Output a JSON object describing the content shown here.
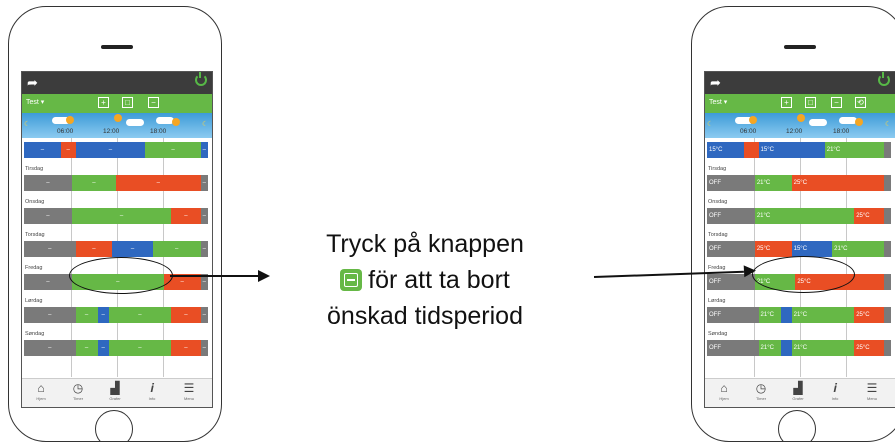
{
  "caption": {
    "line1": "Tryck på knappen",
    "line2": "för att ta bort",
    "line3": "önskad tidsperiod"
  },
  "colors": {
    "green": "#66b846",
    "red": "#e94e24",
    "blue": "#2f68c0",
    "gray": "#7a7a7a"
  },
  "left": {
    "program": "Test",
    "toolbar": [
      "+",
      "□",
      "−"
    ],
    "times": [
      "06:00",
      "12:00",
      "18:00"
    ],
    "rows": [
      {
        "day": "",
        "segs": [
          {
            "c": "blue",
            "w": 0.2,
            "t": "–"
          },
          {
            "c": "red",
            "w": 0.08,
            "t": "–"
          },
          {
            "c": "blue",
            "w": 0.38,
            "t": "–"
          },
          {
            "c": "green",
            "w": 0.3,
            "t": "–"
          },
          {
            "c": "blue",
            "w": 0.04,
            "t": "–"
          }
        ]
      },
      {
        "day": "Tirsdag",
        "segs": [
          {
            "c": "gray",
            "w": 0.26,
            "t": "–"
          },
          {
            "c": "green",
            "w": 0.24,
            "t": "–"
          },
          {
            "c": "red",
            "w": 0.46,
            "t": "–"
          },
          {
            "c": "gray",
            "w": 0.04,
            "t": "–"
          }
        ]
      },
      {
        "day": "Onsdag",
        "segs": [
          {
            "c": "gray",
            "w": 0.26,
            "t": "–"
          },
          {
            "c": "green",
            "w": 0.54,
            "t": "–"
          },
          {
            "c": "red",
            "w": 0.16,
            "t": "–"
          },
          {
            "c": "gray",
            "w": 0.04,
            "t": "–"
          }
        ]
      },
      {
        "day": "Torsdag",
        "segs": [
          {
            "c": "gray",
            "w": 0.28,
            "t": "–"
          },
          {
            "c": "red",
            "w": 0.2,
            "t": "–"
          },
          {
            "c": "blue",
            "w": 0.22,
            "t": "–"
          },
          {
            "c": "green",
            "w": 0.26,
            "t": "–"
          },
          {
            "c": "gray",
            "w": 0.04,
            "t": "–"
          }
        ]
      },
      {
        "day": "Fredag",
        "segs": [
          {
            "c": "gray",
            "w": 0.26,
            "t": "–"
          },
          {
            "c": "green",
            "w": 0.5,
            "t": "–"
          },
          {
            "c": "red",
            "w": 0.2,
            "t": "–"
          },
          {
            "c": "gray",
            "w": 0.04,
            "t": "–"
          }
        ]
      },
      {
        "day": "Lørdag",
        "segs": [
          {
            "c": "gray",
            "w": 0.28,
            "t": "–"
          },
          {
            "c": "green",
            "w": 0.12,
            "t": "–"
          },
          {
            "c": "blue",
            "w": 0.06,
            "t": "–"
          },
          {
            "c": "green",
            "w": 0.34,
            "t": "–"
          },
          {
            "c": "red",
            "w": 0.16,
            "t": "–"
          },
          {
            "c": "gray",
            "w": 0.04,
            "t": "–"
          }
        ]
      },
      {
        "day": "Søndag",
        "segs": [
          {
            "c": "gray",
            "w": 0.28,
            "t": "–"
          },
          {
            "c": "green",
            "w": 0.12,
            "t": "–"
          },
          {
            "c": "blue",
            "w": 0.06,
            "t": "–"
          },
          {
            "c": "green",
            "w": 0.34,
            "t": "–"
          },
          {
            "c": "red",
            "w": 0.16,
            "t": "–"
          },
          {
            "c": "gray",
            "w": 0.04,
            "t": "–"
          }
        ]
      }
    ],
    "nav": [
      {
        "icon": "⌂",
        "label": "Hjem"
      },
      {
        "icon": "◷",
        "label": "Timer"
      },
      {
        "icon": "▟",
        "label": "Grafer"
      },
      {
        "icon": "𝒊",
        "label": "Info"
      },
      {
        "icon": "☰",
        "label": "Menu"
      }
    ]
  },
  "right": {
    "program": "Test",
    "toolbar": [
      "+",
      "□",
      "−",
      "⟲"
    ],
    "times": [
      "06:00",
      "12:00",
      "18:00"
    ],
    "rows": [
      {
        "day": "",
        "segs": [
          {
            "c": "blue",
            "w": 0.2,
            "t": "15°C"
          },
          {
            "c": "red",
            "w": 0.08,
            "t": ""
          },
          {
            "c": "blue",
            "w": 0.36,
            "t": "15°C"
          },
          {
            "c": "green",
            "w": 0.32,
            "t": "21°C"
          },
          {
            "c": "gray",
            "w": 0.04,
            "t": ""
          }
        ]
      },
      {
        "day": "Tirsdag",
        "segs": [
          {
            "c": "gray",
            "w": 0.26,
            "t": "OFF"
          },
          {
            "c": "green",
            "w": 0.2,
            "t": "21°C"
          },
          {
            "c": "red",
            "w": 0.5,
            "t": "25°C"
          },
          {
            "c": "gray",
            "w": 0.04,
            "t": ""
          }
        ]
      },
      {
        "day": "Onsdag",
        "segs": [
          {
            "c": "gray",
            "w": 0.26,
            "t": "OFF"
          },
          {
            "c": "green",
            "w": 0.54,
            "t": "21°C"
          },
          {
            "c": "red",
            "w": 0.16,
            "t": "25°C"
          },
          {
            "c": "gray",
            "w": 0.04,
            "t": ""
          }
        ]
      },
      {
        "day": "Torsdag",
        "segs": [
          {
            "c": "gray",
            "w": 0.26,
            "t": "OFF"
          },
          {
            "c": "red",
            "w": 0.2,
            "t": "25°C"
          },
          {
            "c": "blue",
            "w": 0.22,
            "t": "15°C"
          },
          {
            "c": "green",
            "w": 0.28,
            "t": "21°C"
          },
          {
            "c": "gray",
            "w": 0.04,
            "t": ""
          }
        ]
      },
      {
        "day": "Fredag",
        "segs": [
          {
            "c": "gray",
            "w": 0.26,
            "t": "OFF"
          },
          {
            "c": "green",
            "w": 0.22,
            "t": "21°C"
          },
          {
            "c": "red",
            "w": 0.48,
            "t": "25°C"
          },
          {
            "c": "gray",
            "w": 0.04,
            "t": ""
          }
        ]
      },
      {
        "day": "Lørdag",
        "segs": [
          {
            "c": "gray",
            "w": 0.28,
            "t": "OFF"
          },
          {
            "c": "green",
            "w": 0.12,
            "t": "21°C"
          },
          {
            "c": "blue",
            "w": 0.06,
            "t": ""
          },
          {
            "c": "green",
            "w": 0.34,
            "t": "21°C"
          },
          {
            "c": "red",
            "w": 0.16,
            "t": "25°C"
          },
          {
            "c": "gray",
            "w": 0.04,
            "t": ""
          }
        ]
      },
      {
        "day": "Søndag",
        "segs": [
          {
            "c": "gray",
            "w": 0.28,
            "t": "OFF"
          },
          {
            "c": "green",
            "w": 0.12,
            "t": "21°C"
          },
          {
            "c": "blue",
            "w": 0.06,
            "t": ""
          },
          {
            "c": "green",
            "w": 0.34,
            "t": "21°C"
          },
          {
            "c": "red",
            "w": 0.16,
            "t": "25°C"
          },
          {
            "c": "gray",
            "w": 0.04,
            "t": ""
          }
        ]
      }
    ],
    "nav": [
      {
        "icon": "⌂",
        "label": "Hjem"
      },
      {
        "icon": "◷",
        "label": "Timer"
      },
      {
        "icon": "▟",
        "label": "Grafer"
      },
      {
        "icon": "𝒊",
        "label": "Info"
      },
      {
        "icon": "☰",
        "label": "Menu"
      }
    ]
  }
}
